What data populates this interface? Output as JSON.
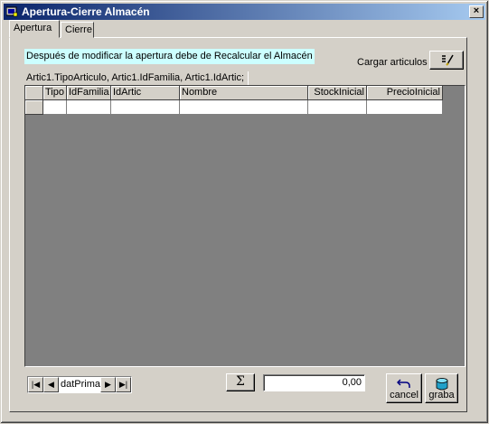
{
  "window": {
    "title": "Apertura-Cierre Almacén",
    "close_label": "×"
  },
  "tabs": [
    {
      "label": "Apertura"
    },
    {
      "label": "Cierre"
    }
  ],
  "info_text": "Después de modificar la apertura debe de Recalcular el Almacén",
  "cargar_label": "Cargar articulos",
  "order_text": "Artic1.TipoArticulo, Artic1.IdFamilia, Artic1.IdArtic;",
  "grid": {
    "columns": [
      "Tipo",
      "IdFamilia",
      "IdArtic",
      "Nombre",
      "StockInicial",
      "PrecioInicial"
    ]
  },
  "navigator": {
    "caption": "datPrimari",
    "first": "|◀",
    "prev": "◀",
    "next": "▶",
    "last": "▶|"
  },
  "sigma_label": "Σ",
  "total_value": "0,00",
  "buttons": {
    "cancel": "cancel",
    "save": "graba"
  }
}
